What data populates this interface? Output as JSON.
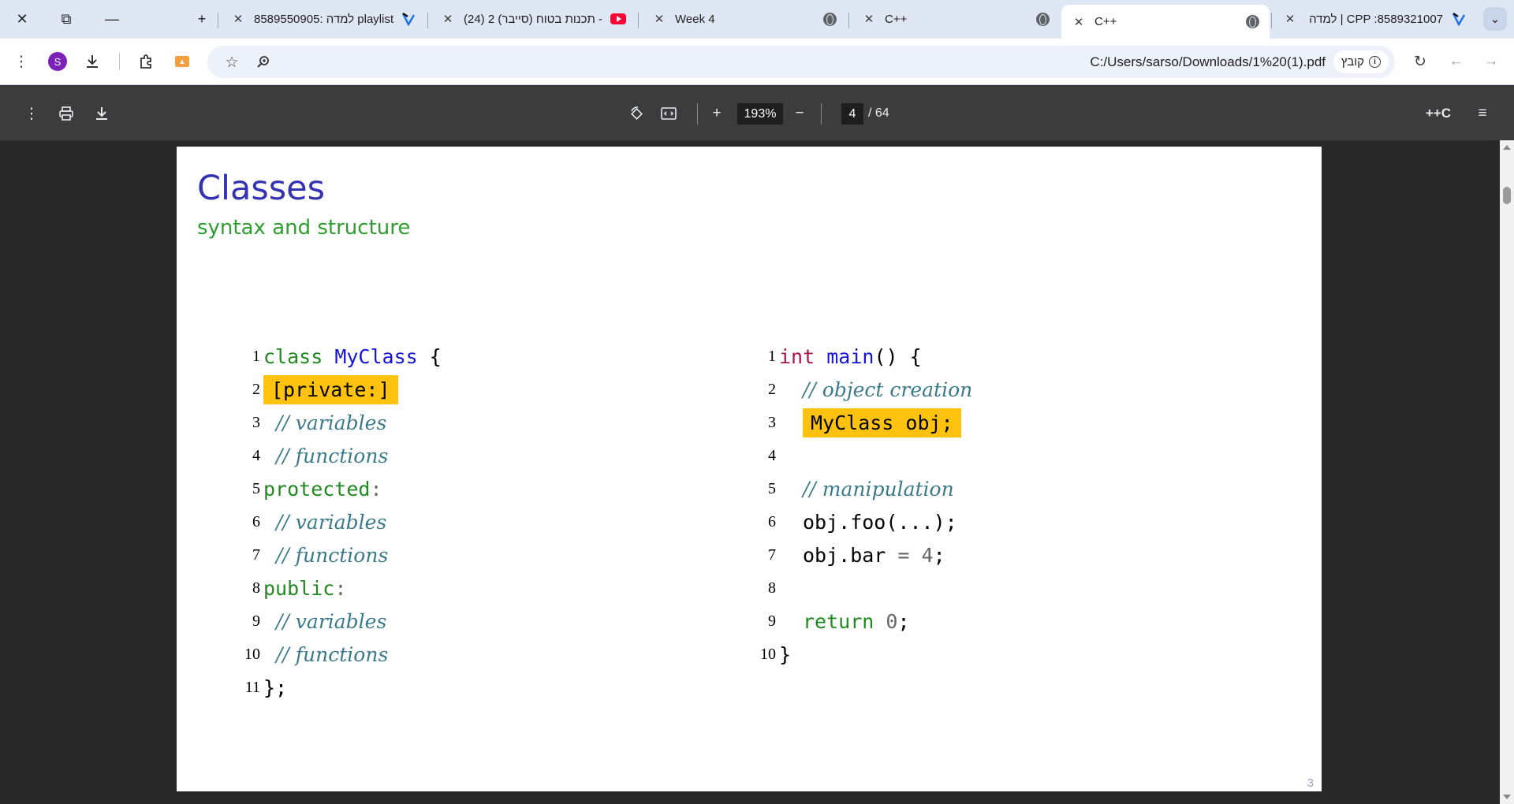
{
  "tabs": [
    {
      "title": "למדה | CPP :8589321007",
      "icon": "learn-icon",
      "active": false
    },
    {
      "title": "C++",
      "icon": "globe-icon",
      "active": true
    },
    {
      "title": "C++",
      "icon": "globe-icon",
      "active": false
    },
    {
      "title": "Week 4",
      "icon": "globe-icon",
      "active": false
    },
    {
      "title": "(24) תכנות בטוח (סייבר) 2 -",
      "icon": "youtube-icon",
      "active": false
    },
    {
      "title": "למדה :8589550905 playlist",
      "icon": "learn-icon",
      "active": false
    }
  ],
  "toolbar": {
    "url": "C:/Users/sarso/Downloads/1%20(1).pdf",
    "chip_label": "קובץ",
    "avatar_letter": "S"
  },
  "pdf": {
    "zoom": "193%",
    "current_page": "4",
    "total_pages": "/ 64",
    "doc_title": "++C"
  },
  "slide": {
    "title": "Classes",
    "subtitle": "syntax and structure",
    "page_number": "3",
    "left_code": [
      {
        "n": "1"
      },
      {
        "n": "2"
      },
      {
        "n": "3"
      },
      {
        "n": "4"
      },
      {
        "n": "5"
      },
      {
        "n": "6"
      },
      {
        "n": "7"
      },
      {
        "n": "8"
      },
      {
        "n": "9"
      },
      {
        "n": "10"
      },
      {
        "n": "11"
      }
    ],
    "right_code": [
      {
        "n": "1"
      },
      {
        "n": "2"
      },
      {
        "n": "3"
      },
      {
        "n": "4"
      },
      {
        "n": "5"
      },
      {
        "n": "6"
      },
      {
        "n": "7"
      },
      {
        "n": "8"
      },
      {
        "n": "9"
      },
      {
        "n": "10"
      }
    ],
    "tokens": {
      "class_kw": "class",
      "myclass": "MyClass",
      "brace_open": " {",
      "private_label": "[private:]",
      "comment_variables": "// variables",
      "comment_functions": "// functions",
      "protected_kw": "protected",
      "public_kw": "public",
      "colon": ":",
      "closing": "};",
      "int_kw": "int",
      "main_fn": "main",
      "main_rest": "() {",
      "comment_object_creation": "// object creation",
      "myclass_obj": "MyClass obj;",
      "comment_manipulation": "// manipulation",
      "obj_foo": "obj.foo(...);",
      "obj_bar": "obj.bar",
      "equals": " = ",
      "four": "4",
      "semi": ";",
      "return_kw": "return",
      "zero": "0",
      "close_brace": "}"
    }
  },
  "colors": {
    "title": "#3333b3",
    "subtitle": "#2e9e2e",
    "keyword": "#1f8a1f",
    "highlight": "#ffc20e",
    "comment": "#3a7a8a"
  }
}
